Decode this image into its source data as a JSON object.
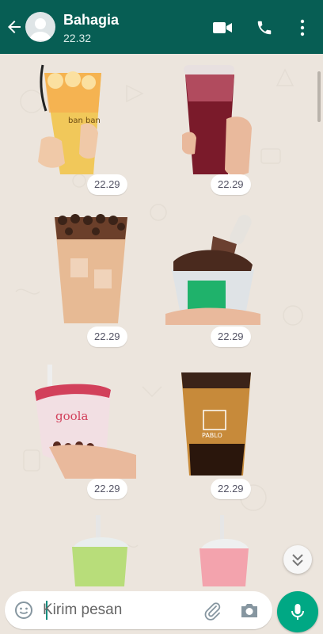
{
  "header": {
    "contact_name": "Bahagia",
    "status": "22.32",
    "icons": [
      "arrow-left-icon",
      "person-icon",
      "video-camera-icon",
      "phone-icon",
      "more-vert-icon"
    ],
    "bg_color": "#075e54"
  },
  "messages": [
    {
      "type": "sticker",
      "art": "peach-tea-cup",
      "caption": "ban ban",
      "time": "22.29"
    },
    {
      "type": "sticker",
      "art": "red-drink-cup",
      "time": "22.29"
    },
    {
      "type": "sticker",
      "art": "boba-milk-tea",
      "time": "22.29"
    },
    {
      "type": "sticker",
      "art": "chocolate-ice-cream-cup",
      "time": "22.29"
    },
    {
      "type": "sticker",
      "art": "pink-boba-cup",
      "caption": "goola",
      "time": "22.29"
    },
    {
      "type": "sticker",
      "art": "brown-sugar-boba",
      "caption": "PABLO",
      "time": "22.29"
    },
    {
      "type": "sticker",
      "art": "green-drink-cup"
    },
    {
      "type": "sticker",
      "art": "pink-drink-cup"
    }
  ],
  "composer": {
    "placeholder": "Kirim pesan",
    "value": "",
    "icons": [
      "emoji-icon",
      "paperclip-icon",
      "camera-icon",
      "mic-icon"
    ]
  },
  "colors": {
    "accent": "#00a884",
    "chat_bg": "#ece5dd"
  }
}
